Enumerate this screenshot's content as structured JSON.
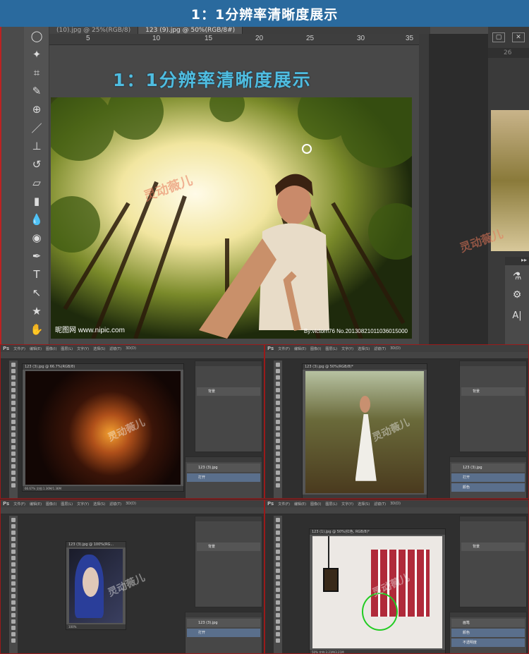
{
  "banner": {
    "title": "1：1分辨率清晰度展示"
  },
  "top_window": {
    "tabs": [
      "(10).jpg @ 25%(RGB/8)",
      "123 (9).jpg @ 50%(RGB/8#)"
    ],
    "ruler_labels": [
      "5",
      "10",
      "15",
      "20",
      "25",
      "30",
      "35"
    ],
    "right_ruler_label": "26",
    "overlay_title": "1：1分辨率清晰度展示",
    "photo_credit_left": "昵图网 www.nipic.com",
    "photo_credit_right": "By:victorn76  No.20130821011036015000",
    "watermark": "灵动薇儿",
    "tools": [
      "lasso-tool",
      "magic-wand-tool",
      "crop-tool",
      "eyedropper-tool",
      "healing-brush-tool",
      "brush-tool",
      "clone-stamp-tool",
      "history-brush-tool",
      "eraser-tool",
      "gradient-tool",
      "blur-tool",
      "dodge-tool",
      "pen-tool",
      "type-tool",
      "path-selection-tool",
      "shape-tool",
      "hand-tool"
    ],
    "tool_glyphs": [
      "◯",
      "✦",
      "⌗",
      "✎",
      "⊕",
      "／",
      "⊥",
      "↺",
      "▱",
      "▮",
      "💧",
      "◉",
      "✒",
      "T",
      "↖",
      "★",
      "✋"
    ],
    "right_text_tool": "A|"
  },
  "grid": [
    {
      "menu": [
        "Ps",
        "文件(F)",
        "编辑(E)",
        "图像(I)",
        "图层(L)",
        "文字(Y)",
        "选择(S)",
        "滤镜(T)",
        "3D(D)"
      ],
      "window_title": "123 (3).jpg @ 66.7%(RGB/8)",
      "status": "66.67%    文档:1.36M/1.36M",
      "layer": "背景",
      "history": [
        "123 (3).jpg",
        "打开"
      ],
      "watermark": "灵动薇儿"
    },
    {
      "menu": [
        "Ps",
        "文件(F)",
        "编辑(E)",
        "图像(I)",
        "图层(L)",
        "文字(Y)",
        "选择(S)",
        "滤镜(T)",
        "3D(D)"
      ],
      "window_title": "123 (3).jpg @ 50%(RGB/8)*",
      "status": "",
      "layer": "背景",
      "history": [
        "123 (3).jpg",
        "打开",
        "颜色"
      ],
      "watermark": "灵动薇儿"
    },
    {
      "menu": [
        "Ps",
        "文件(F)",
        "编辑(E)",
        "图像(I)",
        "图层(L)",
        "文字(Y)",
        "选择(S)",
        "滤镜(T)",
        "3D(D)"
      ],
      "window_title": "123 (3).jpg @ 100%(RG...",
      "status": "100%",
      "layer": "背景",
      "history": [
        "123 (3).jpg",
        "打开"
      ],
      "watermark": "灵动薇儿"
    },
    {
      "menu": [
        "Ps",
        "文件(F)",
        "编辑(E)",
        "图像(I)",
        "图层(L)",
        "文字(Y)",
        "选择(S)",
        "滤镜(T)",
        "3D(D)"
      ],
      "window_title": "123 (1).jpg @ 50%(红色, RGB/8)*",
      "status": "50%    文档:3.21M/3.21M",
      "layer": "背景",
      "history": [
        "画笔",
        "颜色",
        "不透明度"
      ],
      "watermark": "灵动薇儿"
    }
  ],
  "colors": {
    "banner": "#2a6a9e",
    "overlay_title": "#4fbde0",
    "grid_border": "#9a1a1a"
  }
}
